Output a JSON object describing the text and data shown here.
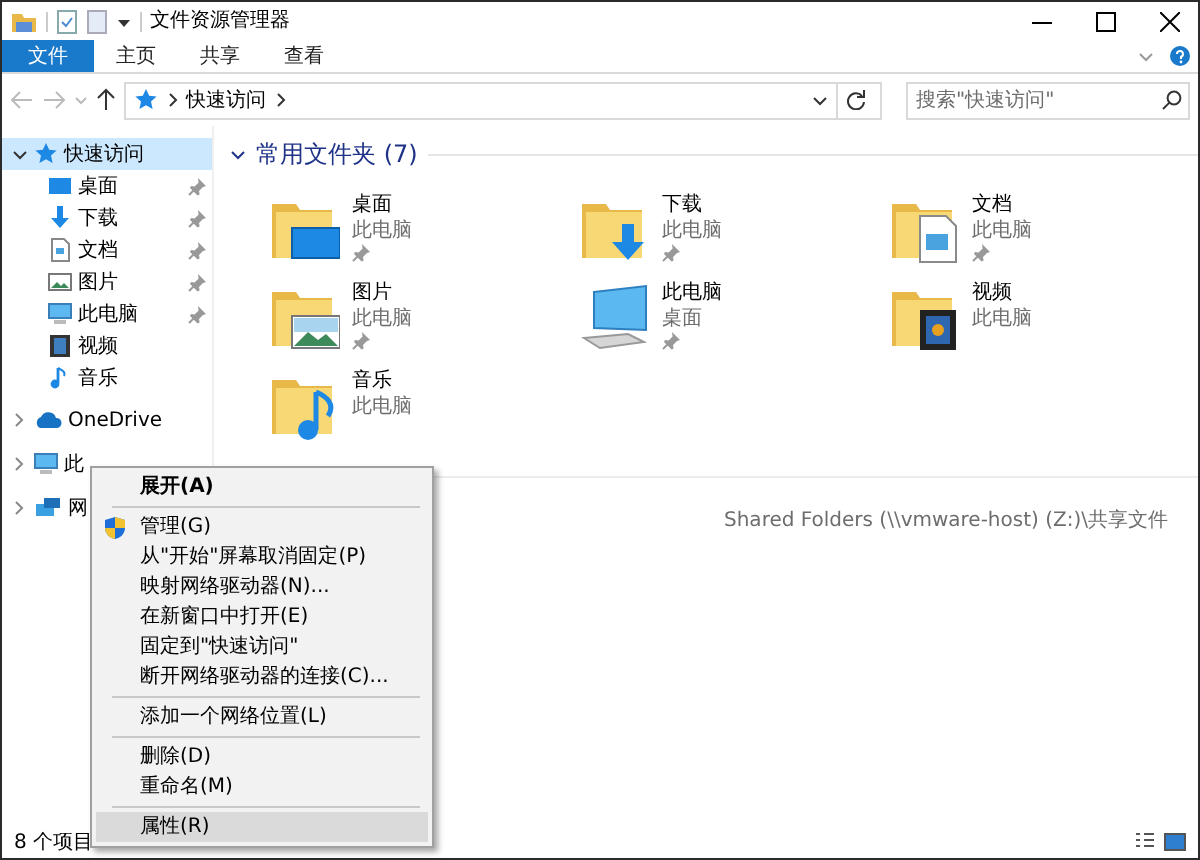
{
  "window": {
    "title": "文件资源管理器"
  },
  "ribbon_tabs": [
    {
      "label": "文件",
      "selected": true
    },
    {
      "label": "主页",
      "selected": false
    },
    {
      "label": "共享",
      "selected": false
    },
    {
      "label": "查看",
      "selected": false
    }
  ],
  "address_bar": {
    "location": "快速访问"
  },
  "search": {
    "placeholder": "搜索\"快速访问\""
  },
  "sidebar": {
    "items": [
      {
        "label": "快速访问",
        "kind": "star",
        "selected": true,
        "expanded": true,
        "children": [
          {
            "label": "桌面",
            "kind": "desktop",
            "pinned": true
          },
          {
            "label": "下载",
            "kind": "download",
            "pinned": true
          },
          {
            "label": "文档",
            "kind": "documents",
            "pinned": true
          },
          {
            "label": "图片",
            "kind": "pictures",
            "pinned": true
          },
          {
            "label": "此电脑",
            "kind": "pc",
            "pinned": true
          },
          {
            "label": "视频",
            "kind": "videos",
            "pinned": false
          },
          {
            "label": "音乐",
            "kind": "music",
            "pinned": false
          }
        ]
      },
      {
        "label": "OneDrive",
        "kind": "cloud",
        "selected": false,
        "expanded": false
      },
      {
        "label": "此",
        "kind": "pc",
        "selected": false,
        "expanded": false
      },
      {
        "label": "网",
        "kind": "network",
        "selected": false,
        "expanded": false
      }
    ]
  },
  "section": {
    "title": "常用文件夹 (7)",
    "expanded": true
  },
  "folders": [
    {
      "name": "桌面",
      "location": "此电脑",
      "kind": "desktop",
      "pinned": true
    },
    {
      "name": "下载",
      "location": "此电脑",
      "kind": "download",
      "pinned": true
    },
    {
      "name": "文档",
      "location": "此电脑",
      "kind": "documents",
      "pinned": true
    },
    {
      "name": "图片",
      "location": "此电脑",
      "kind": "pictures",
      "pinned": true
    },
    {
      "name": "此电脑",
      "location": "桌面",
      "kind": "pc",
      "pinned": true
    },
    {
      "name": "视频",
      "location": "此电脑",
      "kind": "videos",
      "pinned": false
    },
    {
      "name": "音乐",
      "location": "此电脑",
      "kind": "music",
      "pinned": false
    }
  ],
  "recent_files": [
    "Shared Folders (\\\\vmware-host) (Z:)\\共享文件"
  ],
  "status_bar": {
    "item_count": "8 个项目"
  },
  "context_menu": [
    {
      "kind": "item",
      "label": "展开(A)",
      "default": true,
      "selected": false
    },
    {
      "kind": "separator"
    },
    {
      "kind": "shielditem",
      "label": "管理(G)",
      "default": false,
      "selected": false
    },
    {
      "kind": "item",
      "label": "从\"开始\"屏幕取消固定(P)",
      "default": false,
      "selected": false
    },
    {
      "kind": "item",
      "label": "映射网络驱动器(N)...",
      "default": false,
      "selected": false
    },
    {
      "kind": "item",
      "label": "在新窗口中打开(E)",
      "default": false,
      "selected": false
    },
    {
      "kind": "item",
      "label": "固定到\"快速访问\"",
      "default": false,
      "selected": false
    },
    {
      "kind": "item",
      "label": "断开网络驱动器的连接(C)...",
      "default": false,
      "selected": false
    },
    {
      "kind": "separator"
    },
    {
      "kind": "item",
      "label": "添加一个网络位置(L)",
      "default": false,
      "selected": false
    },
    {
      "kind": "separator"
    },
    {
      "kind": "item",
      "label": "删除(D)",
      "default": false,
      "selected": false
    },
    {
      "kind": "item",
      "label": "重命名(M)",
      "default": false,
      "selected": false
    },
    {
      "kind": "separator"
    },
    {
      "kind": "item",
      "label": "属性(R)",
      "default": false,
      "selected": true
    }
  ]
}
